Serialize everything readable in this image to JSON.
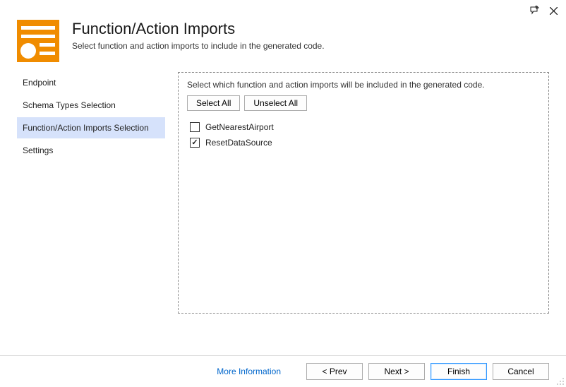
{
  "header": {
    "title": "Function/Action Imports",
    "subtitle": "Select function and action imports to include in the generated code."
  },
  "sidebar": {
    "items": [
      {
        "label": "Endpoint",
        "selected": false
      },
      {
        "label": "Schema Types Selection",
        "selected": false
      },
      {
        "label": "Function/Action Imports Selection",
        "selected": true
      },
      {
        "label": "Settings",
        "selected": false
      }
    ]
  },
  "content": {
    "description": "Select which function and action imports will be included in the generated code.",
    "select_all_label": "Select All",
    "unselect_all_label": "Unselect All",
    "items": [
      {
        "label": "GetNearestAirport",
        "checked": false
      },
      {
        "label": "ResetDataSource",
        "checked": true
      }
    ]
  },
  "footer": {
    "more_info_label": "More Information",
    "prev_label": "< Prev",
    "next_label": "Next >",
    "finish_label": "Finish",
    "cancel_label": "Cancel"
  }
}
